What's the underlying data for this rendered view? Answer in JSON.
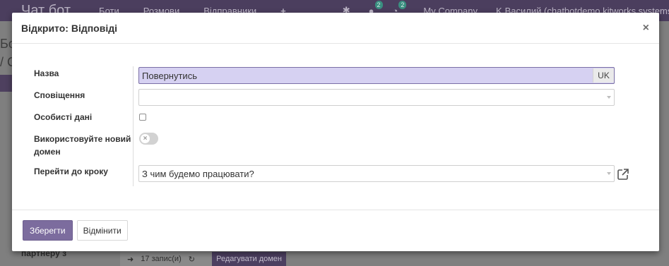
{
  "background": {
    "brand": "Чат бот",
    "menu": [
      "Боти",
      "Розмови",
      "Відправники"
    ],
    "badge_chat": "2",
    "badge_activity": "2",
    "company": "My Company",
    "user": "Василий (chatbotdemo.kitworks.systems)",
    "crumb_1": "Бо",
    "crumb_2": "/ С",
    "partner_text": "партнеру з",
    "record_count": "17 запис(и)",
    "edit_domain_label": "Редагувати домен"
  },
  "modal": {
    "title": "Відкрито: Відповіді",
    "close_symbol": "×",
    "fields": {
      "name_label": "Назва",
      "name_value": "Повернутись",
      "lang_tag": "UK",
      "notification_label": "Сповіщення",
      "notification_value": "",
      "personal_data_label": "Особисті дані",
      "personal_data_checked": false,
      "new_domain_label": "Використовуйте новий домен",
      "new_domain_enabled": false,
      "go_to_step_label": "Перейти до кроку",
      "go_to_step_value": "З чим будемо працювати?"
    },
    "footer": {
      "save_label": "Зберегти",
      "cancel_label": "Відмінити"
    }
  },
  "colors": {
    "navbar": "#4b3e5e",
    "primary_button": "#7c6c9e",
    "name_input_bg": "#d6d1f2",
    "toggle_off": "#d2d2d2"
  },
  "icons": [
    "close-icon",
    "caret-down-icon",
    "external-link-icon",
    "toggle-off-icon",
    "arrow-right-icon",
    "refresh-icon"
  ]
}
